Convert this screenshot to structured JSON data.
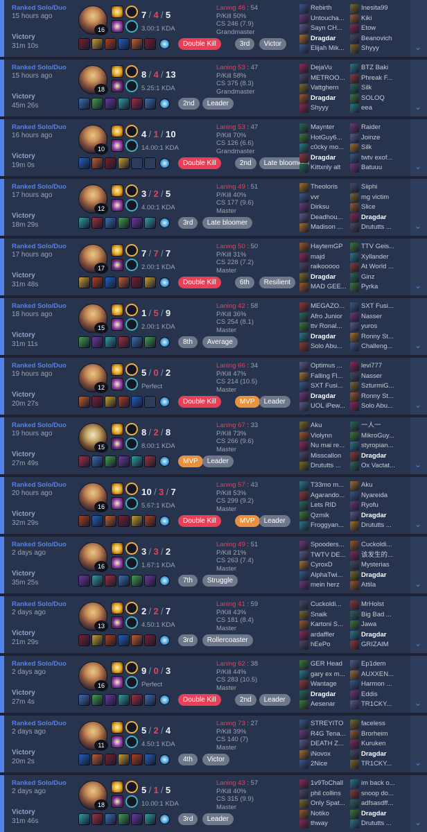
{
  "games": [
    {
      "mode": "Ranked Solo/Duo",
      "ago": "15 hours ago",
      "result": "Victory",
      "duration": "31m 10s",
      "level": "16",
      "k": "7",
      "d": "4",
      "a": "5",
      "ratio": "3.00:1 KDA",
      "laning": "Laning 46",
      "laning_opp": ": 54",
      "pkill": "P/Kill 50%",
      "cs": "CS 246 (7.9)",
      "tier": "Grandmaster",
      "tags": [
        {
          "label": "Double Kill",
          "style": "red"
        },
        {
          "label": "3rd",
          "style": "gray"
        },
        {
          "label": "Victor",
          "style": "gray"
        }
      ],
      "team1": [
        "Rebirth",
        "Untoucha...",
        "Sayn CH...",
        "Dragdar",
        "Elijah Mik..."
      ],
      "team2": [
        "Inesita99",
        "Kiki",
        "Etow",
        "Beanovich",
        "Shyyy"
      ],
      "me_team": 1,
      "me_idx": 3
    },
    {
      "mode": "Ranked Solo/Duo",
      "ago": "15 hours ago",
      "result": "Victory",
      "duration": "45m 26s",
      "level": "18",
      "k": "8",
      "d": "4",
      "a": "13",
      "ratio": "5.25:1 KDA",
      "laning": "Laning 53",
      "laning_opp": ": 47",
      "pkill": "P/Kill 58%",
      "cs": "CS 375 (8.3)",
      "tier": "Grandmaster",
      "tags": [
        {
          "label": "2nd",
          "style": "gray"
        },
        {
          "label": "Leader",
          "style": "gray"
        }
      ],
      "team1": [
        "DejaVu",
        "METROO...",
        "Vattghern",
        "Dragdar",
        "Shyyy"
      ],
      "team2": [
        "BTZ Baki",
        "Phreak F...",
        "Silk",
        "SOLOQ",
        "eea"
      ],
      "me_team": 1,
      "me_idx": 3
    },
    {
      "mode": "Ranked Solo/Duo",
      "ago": "16 hours ago",
      "result": "Victory",
      "duration": "19m 0s",
      "level": "10",
      "k": "4",
      "d": "1",
      "a": "10",
      "ratio": "14.00:1 KDA",
      "laning": "Laning 53",
      "laning_opp": ": 47",
      "pkill": "P/Kill 70%",
      "cs": "CS 126 (6.6)",
      "tier": "Grandmaster",
      "tags": [
        {
          "label": "Double Kill",
          "style": "red"
        },
        {
          "label": "2nd",
          "style": "gray"
        },
        {
          "label": "Late bloomer",
          "style": "gray"
        }
      ],
      "team1": [
        "Maynter",
        "HotGuy6...",
        "c0cky mo...",
        "Dragdar",
        "Kittxnly alt"
      ],
      "team2": [
        "Raider",
        "Joinze",
        "Silk",
        "twtv exof...",
        "Batuuu"
      ],
      "me_team": 1,
      "me_idx": 3
    },
    {
      "mode": "Ranked Solo/Duo",
      "ago": "17 hours ago",
      "result": "Victory",
      "duration": "18m 29s",
      "level": "12",
      "k": "3",
      "d": "2",
      "a": "5",
      "ratio": "4.00:1 KDA",
      "laning": "Laning 49",
      "laning_opp": ": 51",
      "pkill": "P/Kill 40%",
      "cs": "CS 177 (9.6)",
      "tier": "Master",
      "tags": [
        {
          "label": "3rd",
          "style": "gray"
        },
        {
          "label": "Late bloomer",
          "style": "gray"
        }
      ],
      "team1": [
        "Theoloris",
        "vvr",
        "Dirksu",
        "Deadhou...",
        "Madison ..."
      ],
      "team2": [
        "Siiphi",
        "mg victim",
        "Slice",
        "Dragdar",
        "Drututts ..."
      ],
      "me_team": 2,
      "me_idx": 3
    },
    {
      "mode": "Ranked Solo/Duo",
      "ago": "17 hours ago",
      "result": "Victory",
      "duration": "31m 48s",
      "level": "17",
      "k": "7",
      "d": "7",
      "a": "7",
      "ratio": "2.00:1 KDA",
      "laning": "Laning 50",
      "laning_opp": ": 50",
      "pkill": "P/Kill 31%",
      "cs": "CS 228 (7.2)",
      "tier": "Master",
      "tags": [
        {
          "label": "Double Kill",
          "style": "red"
        },
        {
          "label": "6th",
          "style": "gray"
        },
        {
          "label": "Resilient",
          "style": "gray"
        }
      ],
      "team1": [
        "HaytemGP",
        "majd",
        "raikooooo",
        "Dragdar",
        "MAD GEE..."
      ],
      "team2": [
        "TTV Geis...",
        "Xyllander",
        "At World ...",
        "Ginz",
        "Pyrka"
      ],
      "me_team": 1,
      "me_idx": 3
    },
    {
      "mode": "Ranked Solo/Duo",
      "ago": "18 hours ago",
      "result": "Victory",
      "duration": "31m 11s",
      "level": "15",
      "k": "1",
      "d": "5",
      "a": "9",
      "ratio": "2.00:1 KDA",
      "laning": "Laning 42",
      "laning_opp": ": 58",
      "pkill": "P/Kill 36%",
      "cs": "CS 254 (8.1)",
      "tier": "Master",
      "tags": [
        {
          "label": "8th",
          "style": "gray"
        },
        {
          "label": "Average",
          "style": "gray"
        }
      ],
      "team1": [
        "MEGAZO...",
        "Afro Junior",
        "ttv Ronal...",
        "Dragdar",
        "Solo Abu..."
      ],
      "team2": [
        "SXT Fusi...",
        "Nasser",
        "yuros",
        "Ronny St...",
        "Challeng..."
      ],
      "me_team": 1,
      "me_idx": 3
    },
    {
      "mode": "Ranked Solo/Duo",
      "ago": "19 hours ago",
      "result": "Victory",
      "duration": "20m 27s",
      "level": "12",
      "k": "5",
      "d": "0",
      "a": "2",
      "ratio": "Perfect",
      "laning": "Laning 66",
      "laning_opp": ": 34",
      "pkill": "P/Kill 47%",
      "cs": "CS 214 (10.5)",
      "tier": "Master",
      "tags": [
        {
          "label": "Double Kill",
          "style": "red"
        },
        {
          "label": "MVP",
          "style": "gold"
        },
        {
          "label": "Leader",
          "style": "gray"
        }
      ],
      "team1": [
        "Optimus ...",
        "Falling Fl...",
        "SXT Fusi...",
        "Dragdar",
        "UOL iPew..."
      ],
      "team2": [
        "levi777",
        "Nasser",
        "SzturmiG...",
        "Ronny St...",
        "Solo Abu..."
      ],
      "me_team": 1,
      "me_idx": 3
    },
    {
      "mode": "Ranked Solo/Duo",
      "ago": "19 hours ago",
      "result": "Victory",
      "duration": "27m 49s",
      "level": "15",
      "k": "8",
      "d": "2",
      "a": "8",
      "ratio": "8.00:1 KDA",
      "laning": "Laning 67",
      "laning_opp": ": 33",
      "pkill": "P/Kill 73%",
      "cs": "CS 266 (9.6)",
      "tier": "Master",
      "tags": [
        {
          "label": "MVP",
          "style": "gold"
        },
        {
          "label": "Leader",
          "style": "gray"
        }
      ],
      "team1": [
        "Aku",
        "Violynn",
        "Nu mai re...",
        "Misscallon",
        "Drututts ..."
      ],
      "team2": [
        "一人一",
        "MikroGuy...",
        "styropian...",
        "Dragdar",
        "Ox Vactat..."
      ],
      "me_team": 2,
      "me_idx": 3
    },
    {
      "mode": "Ranked Solo/Duo",
      "ago": "20 hours ago",
      "result": "Victory",
      "duration": "32m 29s",
      "level": "16",
      "k": "10",
      "d": "3",
      "a": "7",
      "ratio": "5.67:1 KDA",
      "laning": "Laning 57",
      "laning_opp": ": 43",
      "pkill": "P/Kill 53%",
      "cs": "CS 299 (9.2)",
      "tier": "Master",
      "tags": [
        {
          "label": "Double Kill",
          "style": "red"
        },
        {
          "label": "MVP",
          "style": "gold"
        },
        {
          "label": "Leader",
          "style": "gray"
        }
      ],
      "team1": [
        "T33mo m...",
        "Agarando...",
        "Lets RID",
        "Qzmik",
        "Froggyan..."
      ],
      "team2": [
        "Aku",
        "Nyareida",
        "Ryofu",
        "Dragdar",
        "Drututts ..."
      ],
      "me_team": 2,
      "me_idx": 3
    },
    {
      "mode": "Ranked Solo/Duo",
      "ago": "2 days ago",
      "result": "Victory",
      "duration": "35m 25s",
      "level": "16",
      "k": "3",
      "d": "3",
      "a": "2",
      "ratio": "1.67:1 KDA",
      "laning": "Laning 49",
      "laning_opp": ": 51",
      "pkill": "P/Kill 21%",
      "cs": "CS 263 (7.4)",
      "tier": "Master",
      "tags": [
        {
          "label": "7th",
          "style": "gray"
        },
        {
          "label": "Struggle",
          "style": "gray"
        }
      ],
      "team1": [
        "Spooders...",
        "TWTV DE...",
        "CyroxD",
        "AlphaTwi...",
        "mein herz"
      ],
      "team2": [
        "Cuckoldi...",
        "该发生的...",
        "Mysterias",
        "Dragdar",
        "Attila"
      ],
      "me_team": 2,
      "me_idx": 3
    },
    {
      "mode": "Ranked Solo/Duo",
      "ago": "2 days ago",
      "result": "Victory",
      "duration": "21m 29s",
      "level": "13",
      "k": "2",
      "d": "2",
      "a": "7",
      "ratio": "4.50:1 KDA",
      "laning": "Laning 41",
      "laning_opp": ": 59",
      "pkill": "P/Kill 43%",
      "cs": "CS 181 (8.4)",
      "tier": "Master",
      "tags": [
        {
          "label": "3rd",
          "style": "gray"
        },
        {
          "label": "Rollercoaster",
          "style": "gray"
        }
      ],
      "team1": [
        "Cuckoldi...",
        "Snaik",
        "Kartoni S...",
        "ardaffler",
        "hEePo"
      ],
      "team2": [
        "MrHolst",
        "Big Bad ...",
        "Jawa",
        "Dragdar",
        "GRIZAIM"
      ],
      "me_team": 2,
      "me_idx": 3
    },
    {
      "mode": "Ranked Solo/Duo",
      "ago": "2 days ago",
      "result": "Victory",
      "duration": "27m 4s",
      "level": "16",
      "k": "9",
      "d": "0",
      "a": "3",
      "ratio": "Perfect",
      "laning": "Laning 62",
      "laning_opp": ": 38",
      "pkill": "P/Kill 44%",
      "cs": "CS 283 (10.5)",
      "tier": "Master",
      "tags": [
        {
          "label": "Double Kill",
          "style": "red"
        },
        {
          "label": "2nd",
          "style": "gray"
        },
        {
          "label": "Leader",
          "style": "gray"
        }
      ],
      "team1": [
        "GER Head",
        "gary ex m...",
        "Wantage",
        "Dragdar",
        "Aesenar"
      ],
      "team2": [
        "Ep1dem",
        "AUXXEN...",
        "Harmon ...",
        "Eddis",
        "TR1CKY..."
      ],
      "me_team": 1,
      "me_idx": 3
    },
    {
      "mode": "Ranked Solo/Duo",
      "ago": "2 days ago",
      "result": "Victory",
      "duration": "20m 2s",
      "level": "11",
      "k": "5",
      "d": "2",
      "a": "4",
      "ratio": "4.50:1 KDA",
      "laning": "Laning 73",
      "laning_opp": ": 27",
      "pkill": "P/Kill 39%",
      "cs": "CS 140 (7)",
      "tier": "Master",
      "tags": [
        {
          "label": "4th",
          "style": "gray"
        },
        {
          "label": "Victor",
          "style": "gray"
        }
      ],
      "team1": [
        "STREYITO",
        "R4G Tena...",
        "DEATH Z...",
        "iNovox",
        "2Nice"
      ],
      "team2": [
        "faceless",
        "Brorheim",
        "Kuruken",
        "Dragdar",
        "TR1CKY..."
      ],
      "me_team": 2,
      "me_idx": 3
    },
    {
      "mode": "Ranked Solo/Duo",
      "ago": "2 days ago",
      "result": "Victory",
      "duration": "31m 46s",
      "level": "18",
      "k": "5",
      "d": "1",
      "a": "5",
      "ratio": "10.00:1 KDA",
      "laning": "Laning 43",
      "laning_opp": ": 57",
      "pkill": "P/Kill 40%",
      "cs": "CS 315 (9.9)",
      "tier": "Master",
      "tags": [
        {
          "label": "3rd",
          "style": "gray"
        },
        {
          "label": "Leader",
          "style": "gray"
        }
      ],
      "team1": [
        "1v9ToChall",
        "phil collins",
        "Only Spat...",
        "Notiko",
        "thway"
      ],
      "team2": [
        "im back o...",
        "snoop do...",
        "adfsasdff...",
        "Dragdar",
        "Drututts ..."
      ],
      "me_team": 2,
      "me_idx": 3
    }
  ],
  "expand_icon": "chevron-down-icon",
  "colors": {
    "accent": "#5383e8",
    "death": "#e84057",
    "multikill": "#e84057",
    "mvp": "#e89240",
    "badge": "#6f778a"
  }
}
